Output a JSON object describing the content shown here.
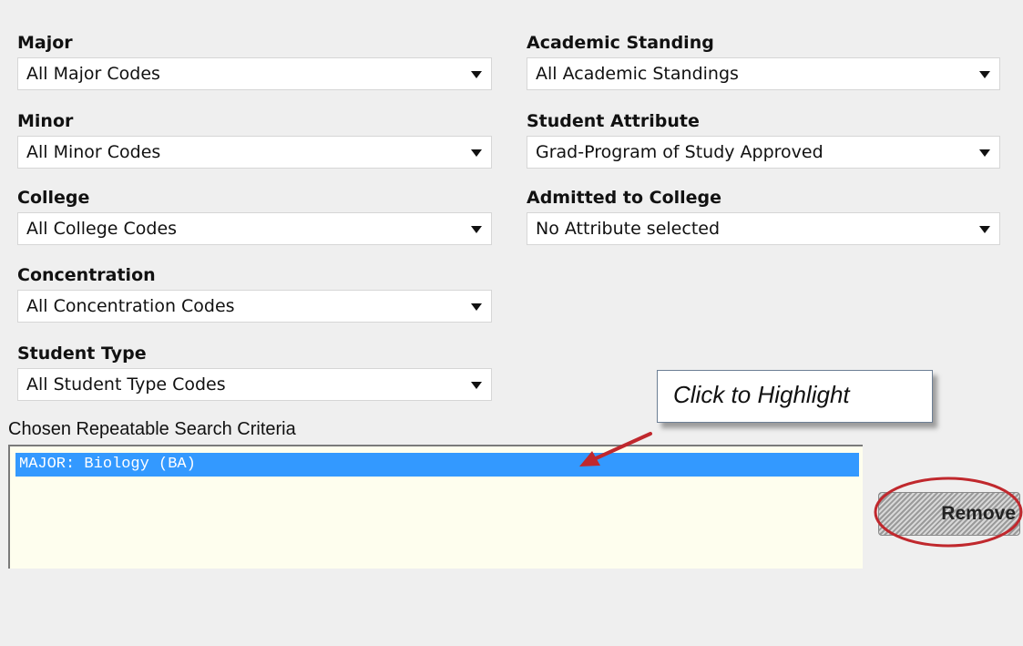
{
  "fields": {
    "major": {
      "label": "Major",
      "value": "All Major Codes"
    },
    "academic_standing": {
      "label": "Academic Standing",
      "value": "All Academic Standings"
    },
    "minor": {
      "label": "Minor",
      "value": "All Minor Codes"
    },
    "student_attribute": {
      "label": "Student Attribute",
      "value": "Grad-Program of Study Approved"
    },
    "college": {
      "label": "College",
      "value": "All College Codes"
    },
    "admitted_to_college": {
      "label": "Admitted to College",
      "value": "No Attribute selected"
    },
    "concentration": {
      "label": "Concentration",
      "value": "All Concentration Codes"
    },
    "student_type": {
      "label": "Student Type",
      "value": "All Student Type Codes"
    }
  },
  "chosen": {
    "label": "Chosen Repeatable Search Criteria",
    "items": [
      "MAJOR: Biology (BA)"
    ],
    "selected_index": 0
  },
  "callout": {
    "text": "Click to Highlight"
  },
  "remove_button": {
    "label": "Remove"
  },
  "colors": {
    "background": "#efefef",
    "selection": "#3399ff",
    "listbox_background": "#fefeee",
    "annotation": "#c0282d"
  },
  "icons": [
    "chevron-down-icon",
    "arrow-annotation",
    "ellipse-annotation"
  ]
}
